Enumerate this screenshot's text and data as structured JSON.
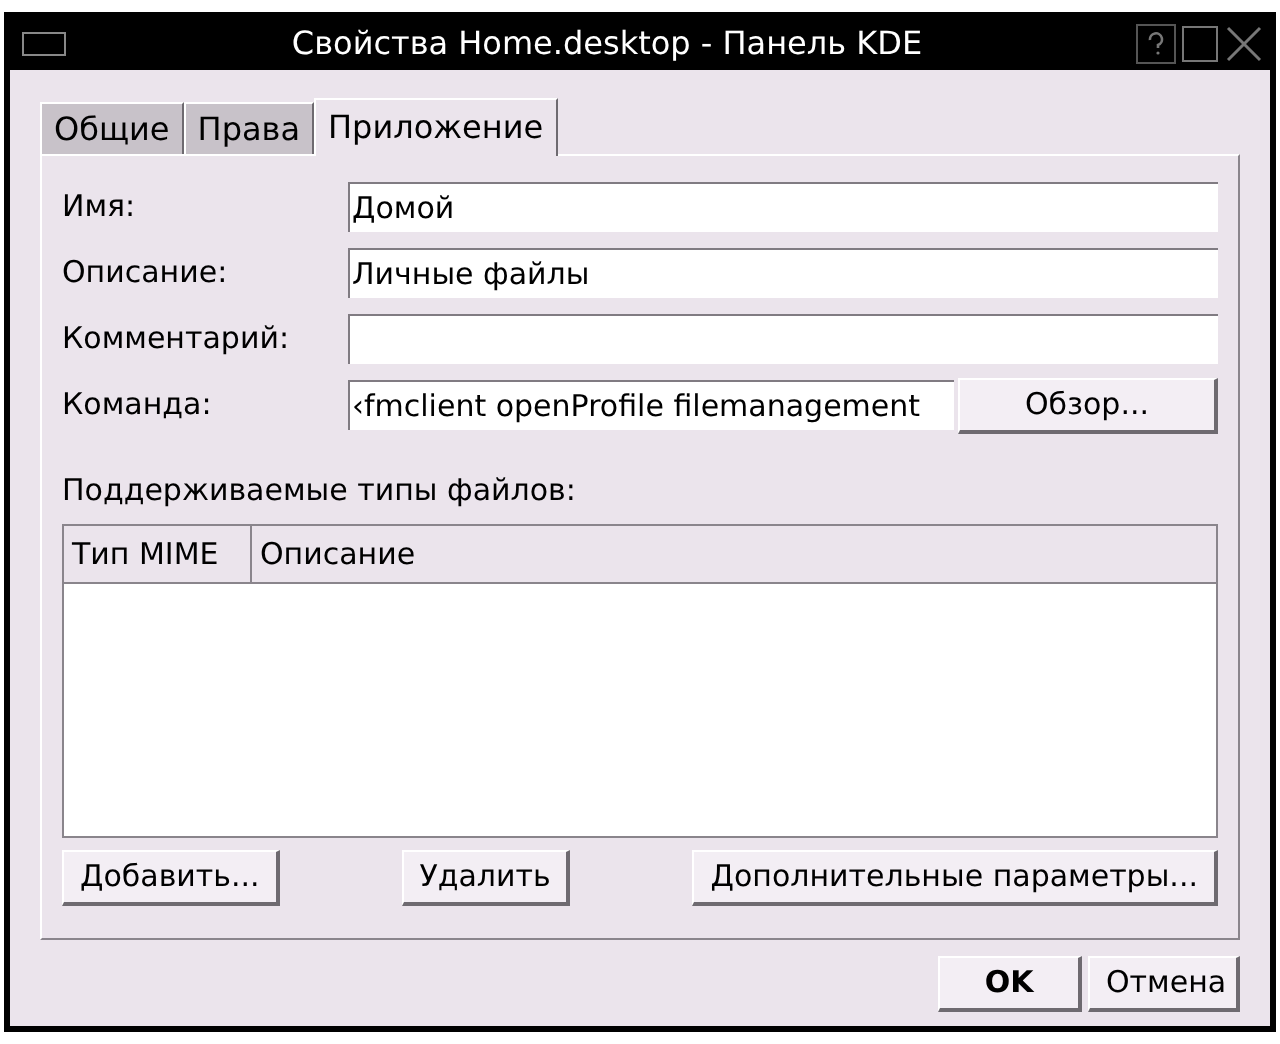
{
  "window": {
    "title": "Свойства Home.desktop - Панель KDE"
  },
  "tabs": [
    {
      "label": "Общие",
      "selected": false
    },
    {
      "label": "Права",
      "selected": false
    },
    {
      "label": "Приложение",
      "selected": true
    }
  ],
  "fields": [
    {
      "label": "Имя:",
      "value": "Домой"
    },
    {
      "label": "Описание:",
      "value": "Личные файлы"
    },
    {
      "label": "Комментарий:"
    },
    {
      "label": "Команда:",
      "value": "‹fmclient openProfile filemanagement",
      "button": "Обзор..."
    }
  ],
  "file_types": {
    "label": "Поддерживаемые типы файлов:",
    "columns": [
      "Тип MIME",
      "Описание"
    ]
  },
  "panel_buttons": [
    "Добавить...",
    "Удалить",
    "Дополнительные параметры..."
  ],
  "dialog_buttons": [
    {
      "label": "OK",
      "default": true
    },
    {
      "label": "Отмена",
      "default": false
    }
  ]
}
